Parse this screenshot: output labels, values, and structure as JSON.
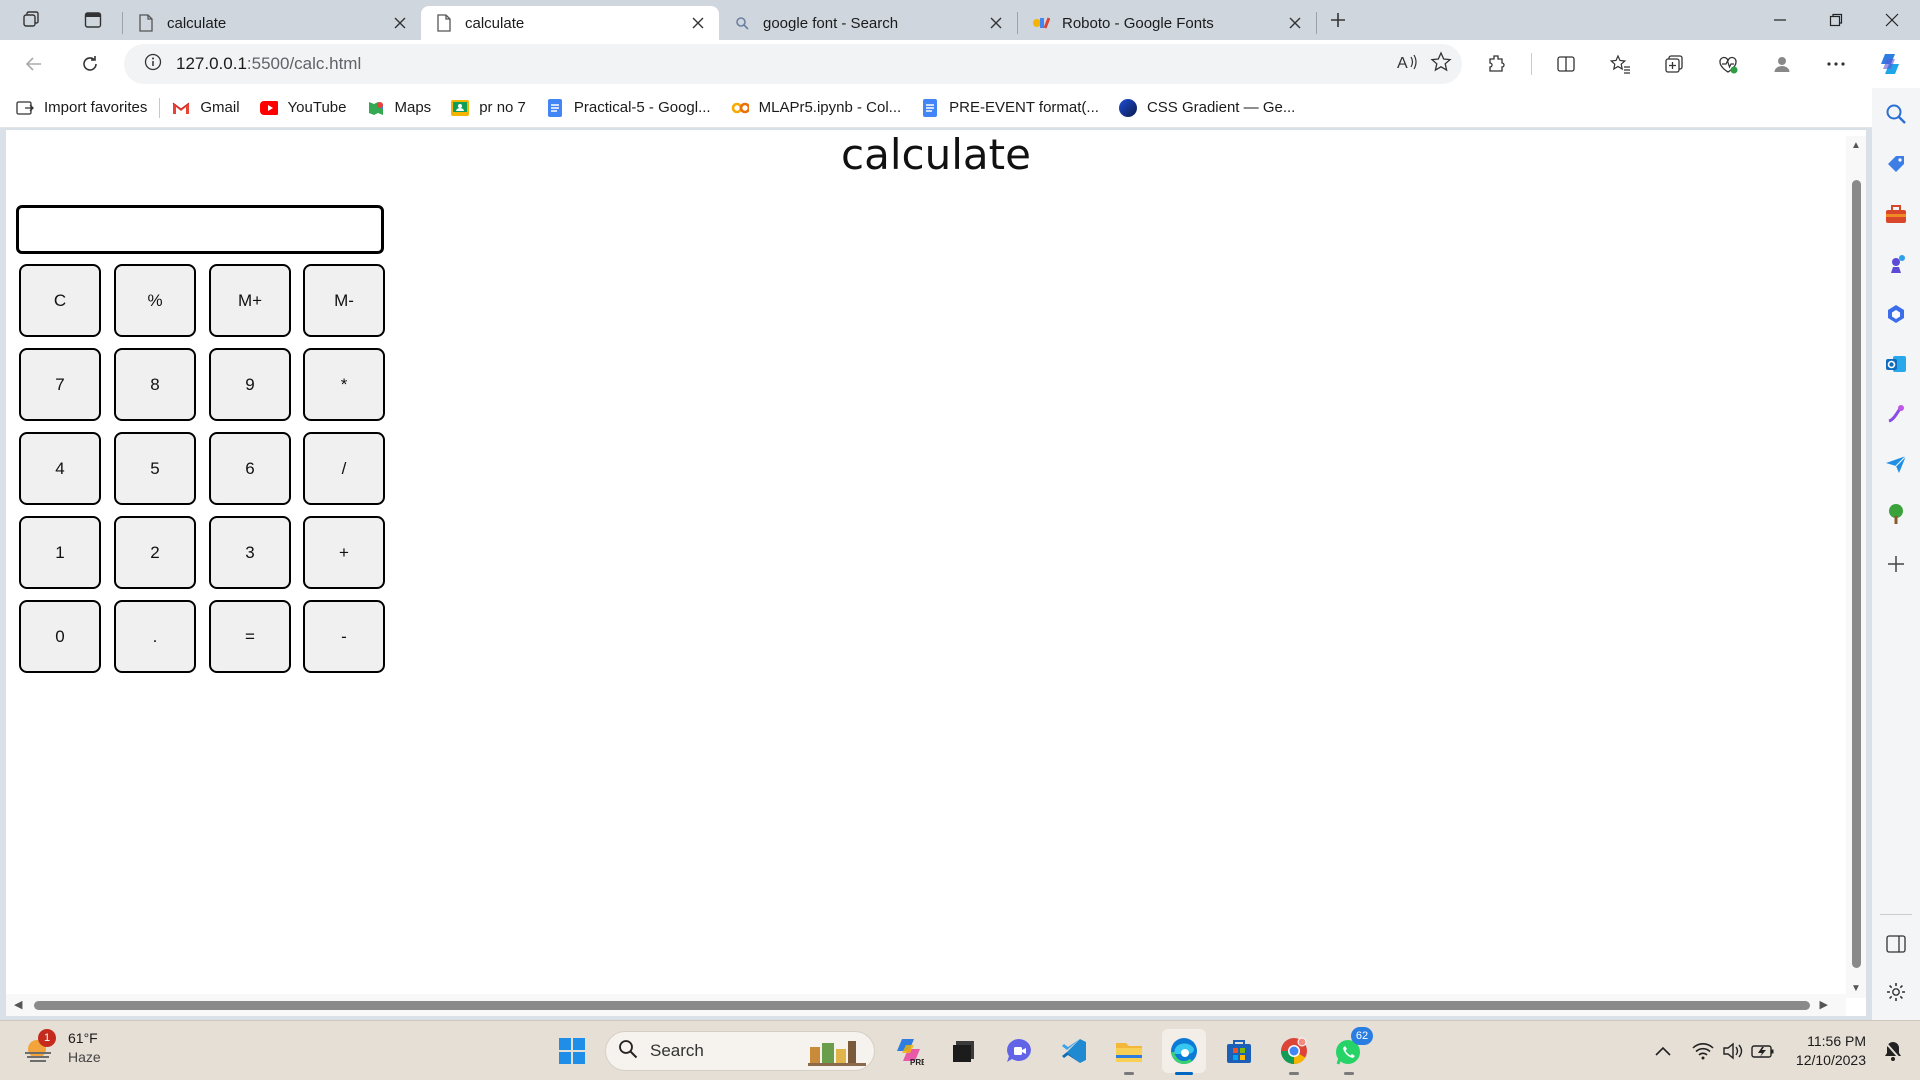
{
  "browser": {
    "tabs": [
      {
        "title": "calculate",
        "active": false,
        "icon": "page-icon"
      },
      {
        "title": "calculate",
        "active": true,
        "icon": "page-icon"
      },
      {
        "title": "google font - Search",
        "active": false,
        "icon": "search-icon"
      },
      {
        "title": "Roboto - Google Fonts",
        "active": false,
        "icon": "google-fonts-icon"
      }
    ],
    "address": {
      "host": "127.0.0.1",
      "path": ":5500/calc.html"
    },
    "favorites": [
      {
        "label": "Import favorites",
        "icon": "import-icon"
      },
      {
        "label": "Gmail",
        "icon": "gmail-icon"
      },
      {
        "label": "YouTube",
        "icon": "youtube-icon"
      },
      {
        "label": "Maps",
        "icon": "maps-icon"
      },
      {
        "label": "pr no 7",
        "icon": "classroom-icon"
      },
      {
        "label": "Practical-5 - Googl...",
        "icon": "docs-icon"
      },
      {
        "label": "MLAPr5.ipynb - Col...",
        "icon": "colab-icon"
      },
      {
        "label": "PRE-EVENT format(...",
        "icon": "docs-icon"
      },
      {
        "label": "CSS Gradient — Ge...",
        "icon": "gradient-icon"
      }
    ]
  },
  "page": {
    "title": "calculate",
    "display_value": "",
    "keys": [
      [
        "C",
        "%",
        "M+",
        "M-"
      ],
      [
        "7",
        "8",
        "9",
        "*"
      ],
      [
        "4",
        "5",
        "6",
        "/"
      ],
      [
        "1",
        "2",
        "3",
        "+"
      ],
      [
        "0",
        ".",
        "=",
        "-"
      ]
    ]
  },
  "taskbar": {
    "weather": {
      "temp": "61°F",
      "condition": "Haze",
      "badge": "1"
    },
    "search_label": "Search",
    "whatsapp_badge": "62",
    "clock": {
      "time": "11:56 PM",
      "date": "12/10/2023"
    }
  },
  "colors": {
    "accent": "#0067c0",
    "key_bg": "#f0f0f0",
    "key_border": "#000000"
  }
}
